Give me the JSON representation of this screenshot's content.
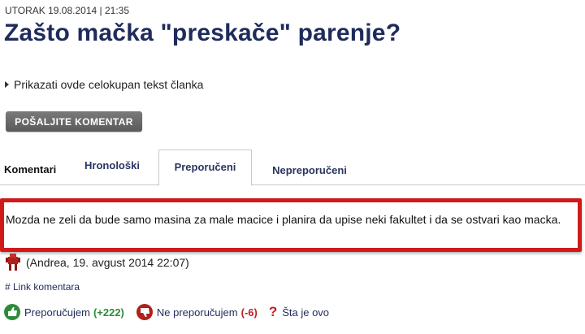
{
  "article": {
    "dateline": "UTORAK 19.08.2014 | 21:35",
    "title": "Zašto mačka \"preskače\" parenje?",
    "show_full_text": "Prikazati ovde celokupan tekst članka",
    "send_comment_button": "POŠALJITE KOMENTAR"
  },
  "comments": {
    "heading": "Komentari",
    "tabs": [
      {
        "label": "Hronološki"
      },
      {
        "label": "Preporučeni",
        "active": true
      },
      {
        "label": "Nepreporučeni"
      }
    ],
    "highlight_color": "#d01a1a",
    "items": [
      {
        "text": "Mozda ne zeli da bude samo masina za male macice i planira da upise neki fakultet i da se ostvari kao macka.",
        "author_line": "(Andrea, 19. avgust 2014 22:07)",
        "permalink": "# Link komentara",
        "recommend_label": "Preporučujem",
        "recommend_count": "(+222)",
        "not_recommend_label": "Ne preporučujem",
        "not_recommend_count": "(-6)",
        "what_is_this": "Šta je ovo"
      }
    ]
  },
  "icons": {
    "avatar": "user-avatar-icon",
    "thumbs_up": "thumbs-up-icon",
    "thumbs_down": "thumbs-down-icon",
    "question": "question-mark-icon"
  }
}
